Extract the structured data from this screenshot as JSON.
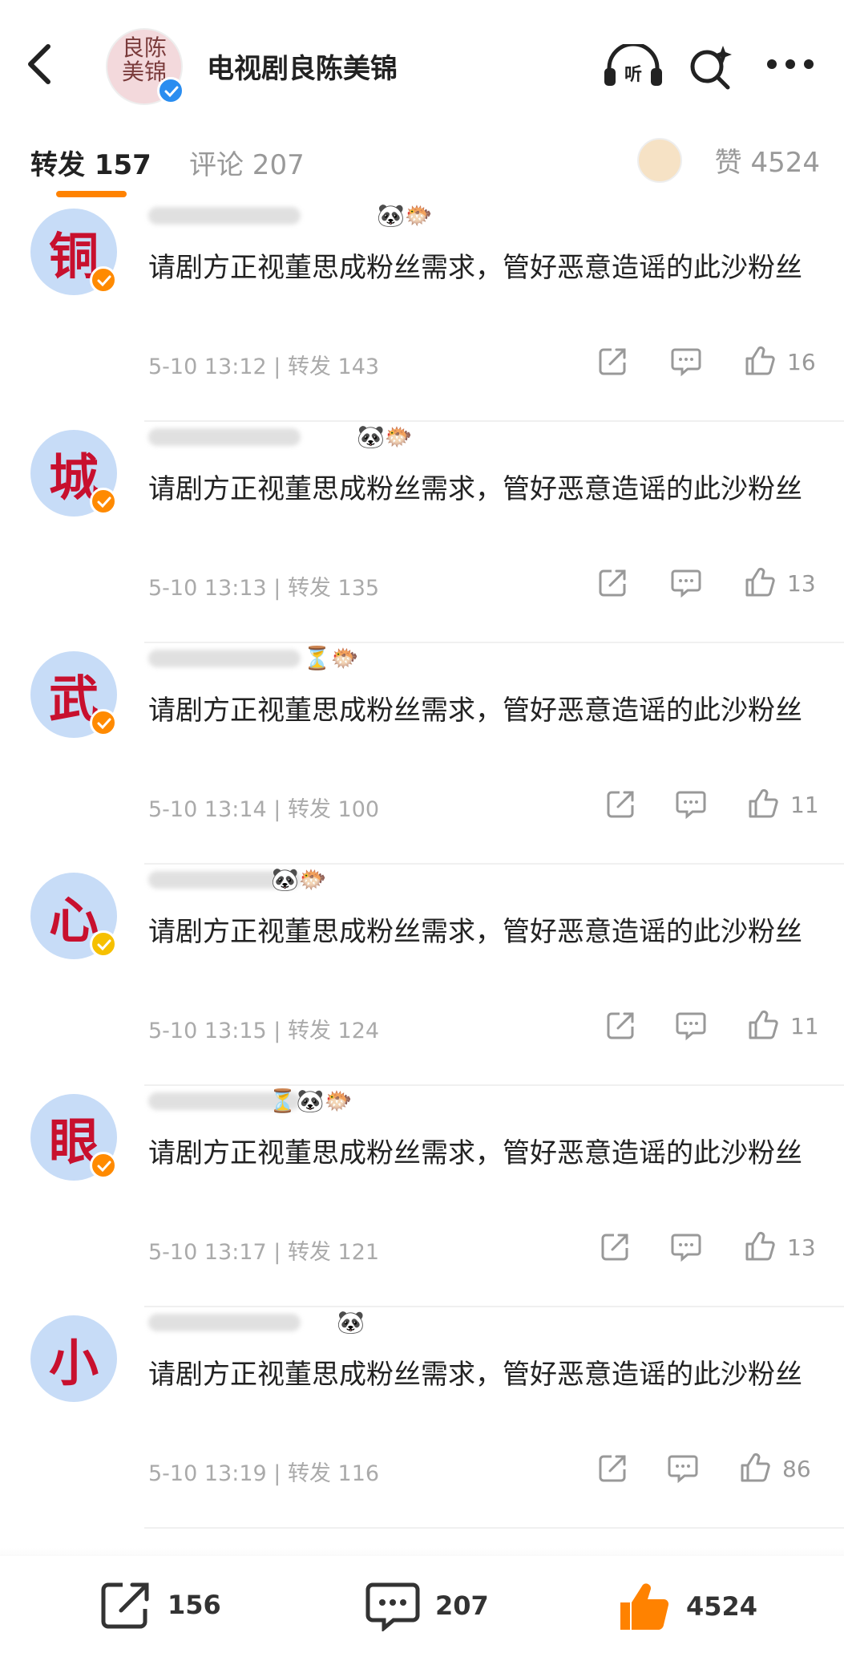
{
  "header": {
    "title": "电视剧良陈美锦",
    "avatar_text": "良陈美锦"
  },
  "tabs": {
    "repost_label": "转发 157",
    "comment_label": "评论 207",
    "like_label": "赞 4524"
  },
  "items": [
    {
      "avatar_char": "铜",
      "name_emojis": "🐼🐡",
      "text": "请剧方正视董思成粉丝需求，管好恶意造谣的此沙粉丝",
      "time": "5-10 13:12",
      "repost": "转发 143",
      "likes": "16",
      "badge": "orange"
    },
    {
      "avatar_char": "城",
      "name_emojis": "🐼🐡",
      "text": "请剧方正视董思成粉丝需求，管好恶意造谣的此沙粉丝",
      "time": "5-10 13:13",
      "repost": "转发 135",
      "likes": "13",
      "badge": "orange"
    },
    {
      "avatar_char": "武",
      "name_emojis": "⏳🐡",
      "text": "请剧方正视董思成粉丝需求，管好恶意造谣的此沙粉丝",
      "time": "5-10 13:14",
      "repost": "转发 100",
      "likes": "11",
      "badge": "orange"
    },
    {
      "avatar_char": "心",
      "name_emojis": "🐼🐡",
      "text": "请剧方正视董思成粉丝需求，管好恶意造谣的此沙粉丝",
      "time": "5-10 13:15",
      "repost": "转发 124",
      "likes": "11",
      "badge": "gold"
    },
    {
      "avatar_char": "眼",
      "name_emojis": "⏳🐼🐡",
      "text": "请剧方正视董思成粉丝需求，管好恶意造谣的此沙粉丝",
      "time": "5-10 13:17",
      "repost": "转发 121",
      "likes": "13",
      "badge": "orange"
    },
    {
      "avatar_char": "小",
      "name_emojis": "🐼",
      "text": "请剧方正视董思成粉丝需求，管好恶意造谣的此沙粉丝",
      "time": "5-10 13:19",
      "repost": "转发 116",
      "likes": "86",
      "badge": "none"
    }
  ],
  "bottom": {
    "repost_count": "156",
    "comment_count": "207",
    "like_count": "4524"
  },
  "colors": {
    "accent": "#ff8200",
    "avatar_bg": "#c7dcf7",
    "avatar_char": "#c8102e",
    "verified": "#2a8df0"
  },
  "icons": [
    "back-icon",
    "listen-icon",
    "search-icon",
    "more-icon",
    "share-icon",
    "comment-icon",
    "thumbs-up-icon"
  ]
}
